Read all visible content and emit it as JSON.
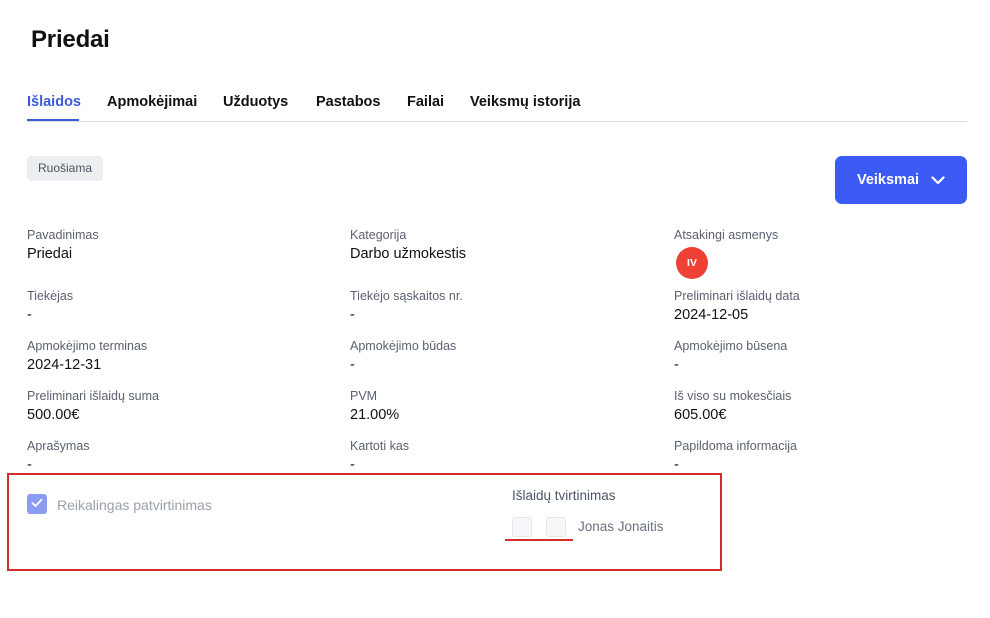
{
  "page": {
    "title": "Priedai"
  },
  "tabs": [
    {
      "label": "Išlaidos",
      "active": true
    },
    {
      "label": "Apmokėjimai",
      "active": false
    },
    {
      "label": "Užduotys",
      "active": false
    },
    {
      "label": "Pastabos",
      "active": false
    },
    {
      "label": "Failai",
      "active": false
    },
    {
      "label": "Veiksmų istorija",
      "active": false
    }
  ],
  "status": {
    "label": "Ruošiama"
  },
  "actions": {
    "label": "Veiksmai",
    "icon": "chevron-down-icon"
  },
  "fields": {
    "name": {
      "label": "Pavadinimas",
      "value": "Priedai"
    },
    "category": {
      "label": "Kategorija",
      "value": "Darbo užmokestis"
    },
    "responsible": {
      "label": "Atsakingi asmenys",
      "avatar_initials": "IV",
      "avatar_color": "#ef4136"
    },
    "supplier": {
      "label": "Tiekėjas",
      "value": "-"
    },
    "supplier_invoice": {
      "label": "Tiekėjo sąskaitos nr.",
      "value": "-"
    },
    "preliminary_date": {
      "label": "Preliminari išlaidų data",
      "value": "2024-12-05"
    },
    "payment_term": {
      "label": "Apmokėjimo terminas",
      "value": "2024-12-31"
    },
    "payment_method": {
      "label": "Apmokėjimo būdas",
      "value": "-"
    },
    "payment_status": {
      "label": "Apmokėjimo būsena",
      "value": "-"
    },
    "preliminary_amount": {
      "label": "Preliminari išlaidų suma",
      "value": "500.00€"
    },
    "vat": {
      "label": "PVM",
      "value": "21.00%"
    },
    "total_with_tax": {
      "label": "Iš viso su mokesčiais",
      "value": "605.00€"
    },
    "description": {
      "label": "Aprašymas",
      "value": "-"
    },
    "repeat": {
      "label": "Kartoti kas",
      "value": "-"
    },
    "additional_info": {
      "label": "Papildoma informacija",
      "value": "-"
    }
  },
  "approval": {
    "required_label": "Reikalingas patvirtinimas",
    "required_checked": true,
    "title": "Išlaidų tvirtinimas",
    "approvers": [
      {
        "name": "Jonas Jonaitis"
      }
    ]
  },
  "colors": {
    "accent": "#3b5bdb",
    "button": "#3b5bf4",
    "highlight": "#d42b2b"
  }
}
